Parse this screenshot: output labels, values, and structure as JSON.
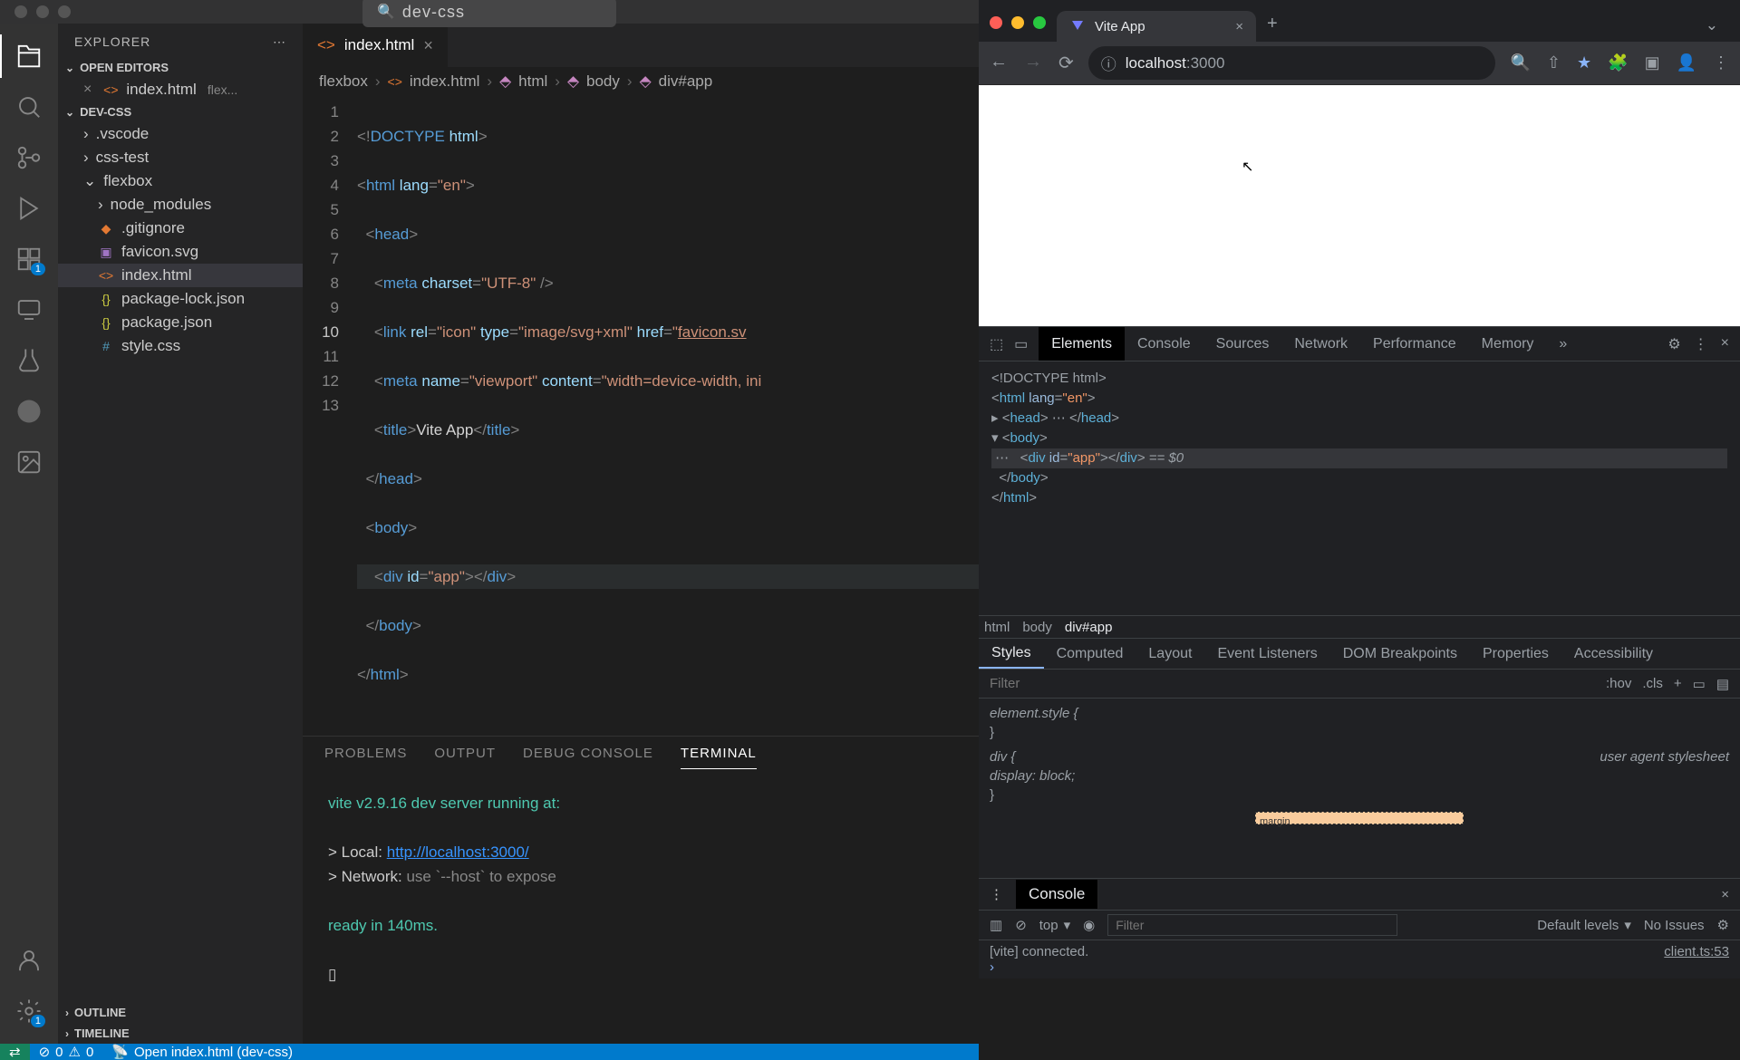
{
  "vscode": {
    "search": "dev-css",
    "explorer_title": "EXPLORER",
    "sections": {
      "open_editors": "OPEN EDITORS",
      "proj": "DEV-CSS",
      "outline": "OUTLINE",
      "timeline": "TIMELINE"
    },
    "open_editor": {
      "name": "index.html",
      "desc": "flex..."
    },
    "files": {
      "vscode": ".vscode",
      "css_test": "css-test",
      "flexbox": "flexbox",
      "node_modules": "node_modules",
      "gitignore": ".gitignore",
      "favicon": "favicon.svg",
      "index": "index.html",
      "pkg_lock": "package-lock.json",
      "pkg": "package.json",
      "style": "style.css"
    },
    "tab": "index.html",
    "breadcrumb": {
      "a": "flexbox",
      "b": "index.html",
      "c": "html",
      "d": "body",
      "e": "div#app"
    },
    "code": {
      "l1a": "<!",
      "l1b": "DOCTYPE",
      "l1c": " html",
      "l1d": ">",
      "l2": "<html lang=\"en\">",
      "l3": "<head>",
      "l4": "<meta charset=\"UTF-8\" />",
      "l5": "<link rel=\"icon\" type=\"image/svg+xml\" href=\"favicon.sv",
      "l6": "<meta name=\"viewport\" content=\"width=device-width, ini",
      "l7": "<title>Vite App</title>",
      "l8": "</head>",
      "l9": "<body>",
      "l10": "<div id=\"app\"></div>",
      "l11": "</body>",
      "l12": "</html>"
    },
    "panel_tabs": {
      "problems": "PROBLEMS",
      "output": "OUTPUT",
      "debug": "DEBUG CONSOLE",
      "terminal": "TERMINAL"
    },
    "terminal": {
      "l1": "vite v2.9.16 dev server running at:",
      "l2a": "> Local:   ",
      "l2b": "http://localhost:3000/",
      "l3a": "> Network: ",
      "l3b": "use `--host` to expose",
      "l4": "ready in 140ms."
    },
    "statusbar": {
      "errors": "0",
      "warnings": "0",
      "live": "Open index.html (dev-css)"
    },
    "badge": "1"
  },
  "browser": {
    "tab": "Vite App",
    "url_host": "localhost",
    "url_port": ":3000",
    "devtools": {
      "tabs": {
        "elements": "Elements",
        "console": "Console",
        "sources": "Sources",
        "network": "Network",
        "performance": "Performance",
        "memory": "Memory"
      },
      "dom": {
        "l1": "<!DOCTYPE html>",
        "l2": "<html lang=\"en\">",
        "l3": "<head>…</head>",
        "l4": "<body>",
        "l5": "<div id=\"app\"></div> == $0",
        "l6": "</body>",
        "l7": "</html>"
      },
      "crumb": {
        "a": "html",
        "b": "body",
        "c": "div#app"
      },
      "styles_tabs": {
        "styles": "Styles",
        "computed": "Computed",
        "layout": "Layout",
        "listeners": "Event Listeners",
        "dom_bp": "DOM Breakpoints",
        "props": "Properties",
        "a11y": "Accessibility"
      },
      "filter_placeholder": "Filter",
      "hov": ":hov",
      "cls": ".cls",
      "style_block": {
        "el": "element.style {",
        "close": "}",
        "div": "div {",
        "ua": "user agent stylesheet",
        "disp_p": "display",
        "disp_v": "block"
      },
      "box_label": "margin",
      "drawer": {
        "title": "Console",
        "context": "top",
        "filter_placeholder": "Filter",
        "levels": "Default levels",
        "issues": "No Issues",
        "msg": "[vite] connected.",
        "src": "client.ts:53"
      }
    }
  }
}
